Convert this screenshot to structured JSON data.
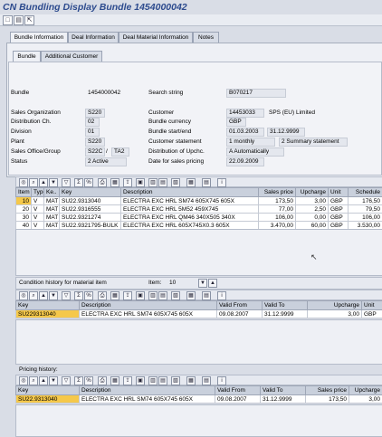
{
  "window": {
    "title": "CN Bundling Display Bundle 1454000042"
  },
  "tabs": [
    {
      "label": "Bundle Information"
    },
    {
      "label": "Deal Information"
    },
    {
      "label": "Deal Material Information"
    },
    {
      "label": "Notes"
    }
  ],
  "subtabs": [
    {
      "label": "Bundle"
    },
    {
      "label": "Additional Customer"
    }
  ],
  "form": {
    "bundle": {
      "label": "Bundle",
      "value": "1454000042"
    },
    "search_string": {
      "label": "Search string",
      "value": "B070217"
    },
    "sales_org": {
      "label": "Sales Organization",
      "value": "S220"
    },
    "customer": {
      "label": "Customer",
      "value": "14453033",
      "name": "SPS (EU) Limited"
    },
    "distribution_ch": {
      "label": "Distribution Ch.",
      "value": "02"
    },
    "bundle_currency": {
      "label": "Bundle currency",
      "value": "GBP"
    },
    "division": {
      "label": "Division",
      "value": "01"
    },
    "bundle_start_end": {
      "label": "Bundle start/end",
      "start": "01.03.2003",
      "end": "31.12.9999"
    },
    "plant": {
      "label": "Plant",
      "value": "S220"
    },
    "customer_statement": {
      "label": "Customer statement",
      "value": "1 monthly",
      "value2": "2 Summary statement"
    },
    "sales_office_group": {
      "label": "Sales Office/Group",
      "office": "S22C",
      "sep": "/",
      "group": "TA2"
    },
    "distribution_upchc": {
      "label": "Distribution of Upchc.",
      "value": "A Automatically"
    },
    "status": {
      "label": "Status",
      "value": "2 Active"
    },
    "date_for_sales_pricing": {
      "label": "Date for sales pricing",
      "value": "22.09.2009"
    }
  },
  "items_grid": {
    "headers": [
      "Item",
      "Type",
      "Ke..",
      "Key",
      "Description",
      "Sales price",
      "Upcharge",
      "Unit",
      "Schedule"
    ],
    "rows": [
      [
        "10",
        "V",
        "MAT",
        "SU22.9313040",
        "ELECTRA EXC HRL SM74 605X745   605X",
        "173,50",
        "3,00",
        "GBP",
        "176,50"
      ],
      [
        "20",
        "V",
        "MAT",
        "SU22.9316555",
        "ELECTRA EXC HRL 5M52   459X745",
        "77,00",
        "2,50",
        "GBP",
        "79,50"
      ],
      [
        "30",
        "V",
        "MAT",
        "SU22.9321274",
        "ELECTRA EXC HRL QM46 340X505   340X",
        "106,00",
        "0,00",
        "GBP",
        "106,00"
      ],
      [
        "40",
        "V",
        "MAT",
        "SU22.9321795-BULK",
        "ELECTRA EXC HRL 605X745X0.3   605X",
        "3.470,00",
        "60,00",
        "GBP",
        "3.530,00"
      ]
    ]
  },
  "condition_history": {
    "title": "Condition history for material item",
    "item_label": "Item:",
    "item_value": "10",
    "headers": [
      "Key",
      "Description",
      "Valid From",
      "Valid To",
      "Upcharge",
      "Unit"
    ],
    "rows": [
      [
        "SU229313040",
        "ELECTRA EXC HRL SM74 605X745   605X",
        "09.08.2007",
        "31.12.9999",
        "3,00",
        "GBP"
      ]
    ]
  },
  "pricing_history": {
    "title": "Pricing history:",
    "headers": [
      "Key",
      "Description",
      "Valid From",
      "Valid To",
      "Sales price",
      "Upcharge"
    ],
    "rows": [
      [
        "SU22.9313040",
        "ELECTRA EXC HRL SM74 605X745   605X",
        "09.08.2007",
        "31.12.9999",
        "173,50",
        "3,00"
      ]
    ]
  },
  "icons": {
    "save": "save-icon",
    "back": "back-icon",
    "exit": "exit-icon",
    "cancel": "cancel-icon"
  },
  "colors": {
    "title": "#2d4b8e",
    "highlight": "#f5c84a",
    "background": "#d9dde6"
  }
}
